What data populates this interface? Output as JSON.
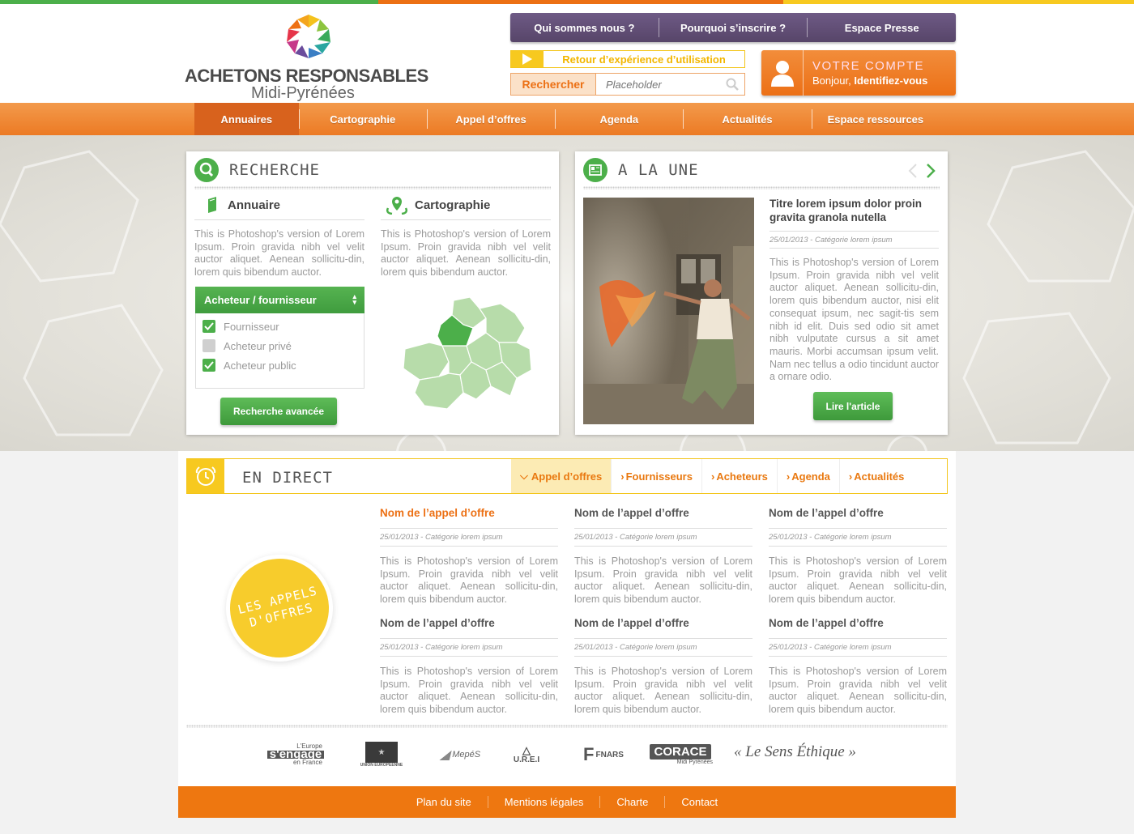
{
  "colors": {
    "orange": "#ec7014",
    "purple": "#5f4c72",
    "green": "#4caf4a",
    "yellow": "#f7c91f"
  },
  "logo": {
    "line1": "ACHETONS RESPONSABLES",
    "line2": "Midi-Pyrénées"
  },
  "topnav": [
    "Qui sommes nous ?",
    "Pourquoi s’inscrire ?",
    "Espace Presse"
  ],
  "retour": "Retour d’expérience d’utilisation",
  "search": {
    "button": "Rechercher",
    "placeholder": "Placeholder"
  },
  "compte": {
    "title": "VOTRE COMPTE",
    "greeting": "Bonjour, ",
    "link": "Identifiez-vous"
  },
  "mainnav": [
    "Annuaires",
    "Cartographie",
    "Appel d’offres",
    "Agenda",
    "Actualités",
    "Espace ressources"
  ],
  "recherche": {
    "title": "RECHERCHE",
    "annuaire": {
      "title": "Annuaire",
      "text": "This is Photoshop's version of Lorem Ipsum. Proin gravida nibh vel velit auctor aliquet. Aenean sollicitu-din, lorem quis bibendum auctor."
    },
    "carto": {
      "title": "Cartographie",
      "text": "This is Photoshop's version of Lorem Ipsum. Proin gravida nibh vel velit auctor aliquet. Aenean sollicitu-din, lorem quis bibendum auctor."
    },
    "select": "Acheteur / fournisseur",
    "options": [
      {
        "label": "Fournisseur",
        "checked": true
      },
      {
        "label": "Acheteur privé",
        "checked": false
      },
      {
        "label": "Acheteur public",
        "checked": true
      }
    ],
    "advanced": "Recherche avancée"
  },
  "une": {
    "title": "A LA UNE",
    "article_title": "Titre lorem ipsum dolor proin gravita granola nutella",
    "date": "25/01/2013 - Catégorie lorem ipsum",
    "text": "This is Photoshop's version of Lorem Ipsum. Proin gravida nibh vel velit auctor aliquet. Aenean sollicitu-din, lorem quis bibendum auctor, nisi elit consequat ipsum, nec sagit-tis sem nibh id elit. Duis sed odio sit amet nibh vulputate cursus a sit amet mauris. Morbi accumsan ipsum velit. Nam nec tellus a odio tincidunt auctor a ornare odio.",
    "button": "Lire l'article"
  },
  "direct": {
    "title": "EN DIRECT",
    "tabs": [
      "Appel d’offres",
      "Fournisseurs",
      "Acheteurs",
      "Agenda",
      "Actualités"
    ],
    "badge_line1": "LES APPELS",
    "badge_line2": "D'OFFRES",
    "cards": [
      {
        "title": "Nom de l’appel d’offre",
        "date": "25/01/2013 - Catégorie lorem ipsum",
        "text": "This is Photoshop's version of Lorem Ipsum. Proin gravida nibh vel velit auctor aliquet. Aenean sollicitu-din, lorem quis bibendum auctor."
      },
      {
        "title": "Nom de l’appel d’offre",
        "date": "25/01/2013 - Catégorie lorem ipsum",
        "text": "This is Photoshop's version of Lorem Ipsum. Proin gravida nibh vel velit auctor aliquet. Aenean sollicitu-din, lorem quis bibendum auctor."
      },
      {
        "title": "Nom de l’appel d’offre",
        "date": "25/01/2013 - Catégorie lorem ipsum",
        "text": "This is Photoshop's version of Lorem Ipsum. Proin gravida nibh vel velit auctor aliquet. Aenean sollicitu-din, lorem quis bibendum auctor."
      },
      {
        "title": "Nom de l’appel d’offre",
        "date": "25/01/2013 - Catégorie lorem ipsum",
        "text": "This is Photoshop's version of Lorem Ipsum. Proin gravida nibh vel velit auctor aliquet. Aenean sollicitu-din, lorem quis bibendum auctor."
      },
      {
        "title": "Nom de l’appel d’offre",
        "date": "25/01/2013 - Catégorie lorem ipsum",
        "text": "This is Photoshop's version of Lorem Ipsum. Proin gravida nibh vel velit auctor aliquet. Aenean sollicitu-din, lorem quis bibendum auctor."
      },
      {
        "title": "Nom de l’appel d’offre",
        "date": "25/01/2013 - Catégorie lorem ipsum",
        "text": "This is Photoshop's version of Lorem Ipsum. Proin gravida nibh vel velit auctor aliquet. Aenean sollicitu-din, lorem quis bibendum auctor."
      }
    ]
  },
  "partners": {
    "europe1": "L'Europe",
    "europe2": "s'engage",
    "europe3": "en France",
    "ue": "UNION EUROPEENNE",
    "mepes": "MepéS",
    "urei": "U.R.E.I",
    "fnars": "FNARS",
    "corace": "CORACE",
    "corace_sub": "Midi Pyrénées",
    "quote": "« Le Sens Éthique »"
  },
  "footer": [
    "Plan du site",
    "Mentions légales",
    "Charte",
    "Contact"
  ]
}
